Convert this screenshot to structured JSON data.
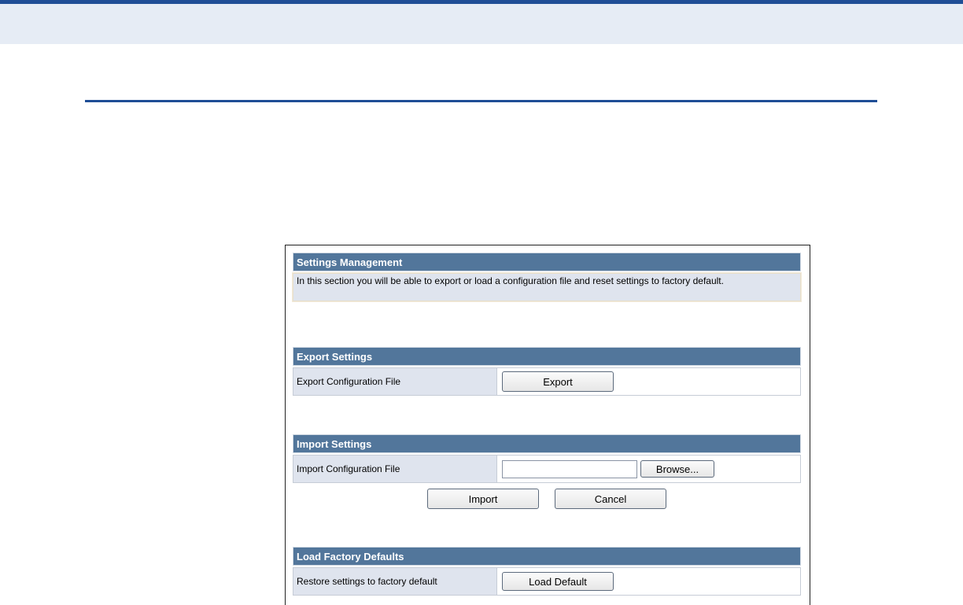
{
  "settings_management": {
    "header": "Settings Management",
    "description": "In this section you will be able to export or load a configuration file and reset settings to factory default."
  },
  "export_settings": {
    "header": "Export Settings",
    "label": "Export Configuration File",
    "button": "Export"
  },
  "import_settings": {
    "header": "Import Settings",
    "label": "Import Configuration File",
    "file_value": "",
    "browse_button": "Browse...",
    "import_button": "Import",
    "cancel_button": "Cancel"
  },
  "load_factory_defaults": {
    "header": "Load Factory Defaults",
    "label": "Restore settings to factory default",
    "button": "Load Default"
  },
  "colors": {
    "top_band": "#e6ecf5",
    "top_border": "#1f4e96",
    "section_header": "#52769b",
    "label_cell": "#dfe4ee"
  }
}
